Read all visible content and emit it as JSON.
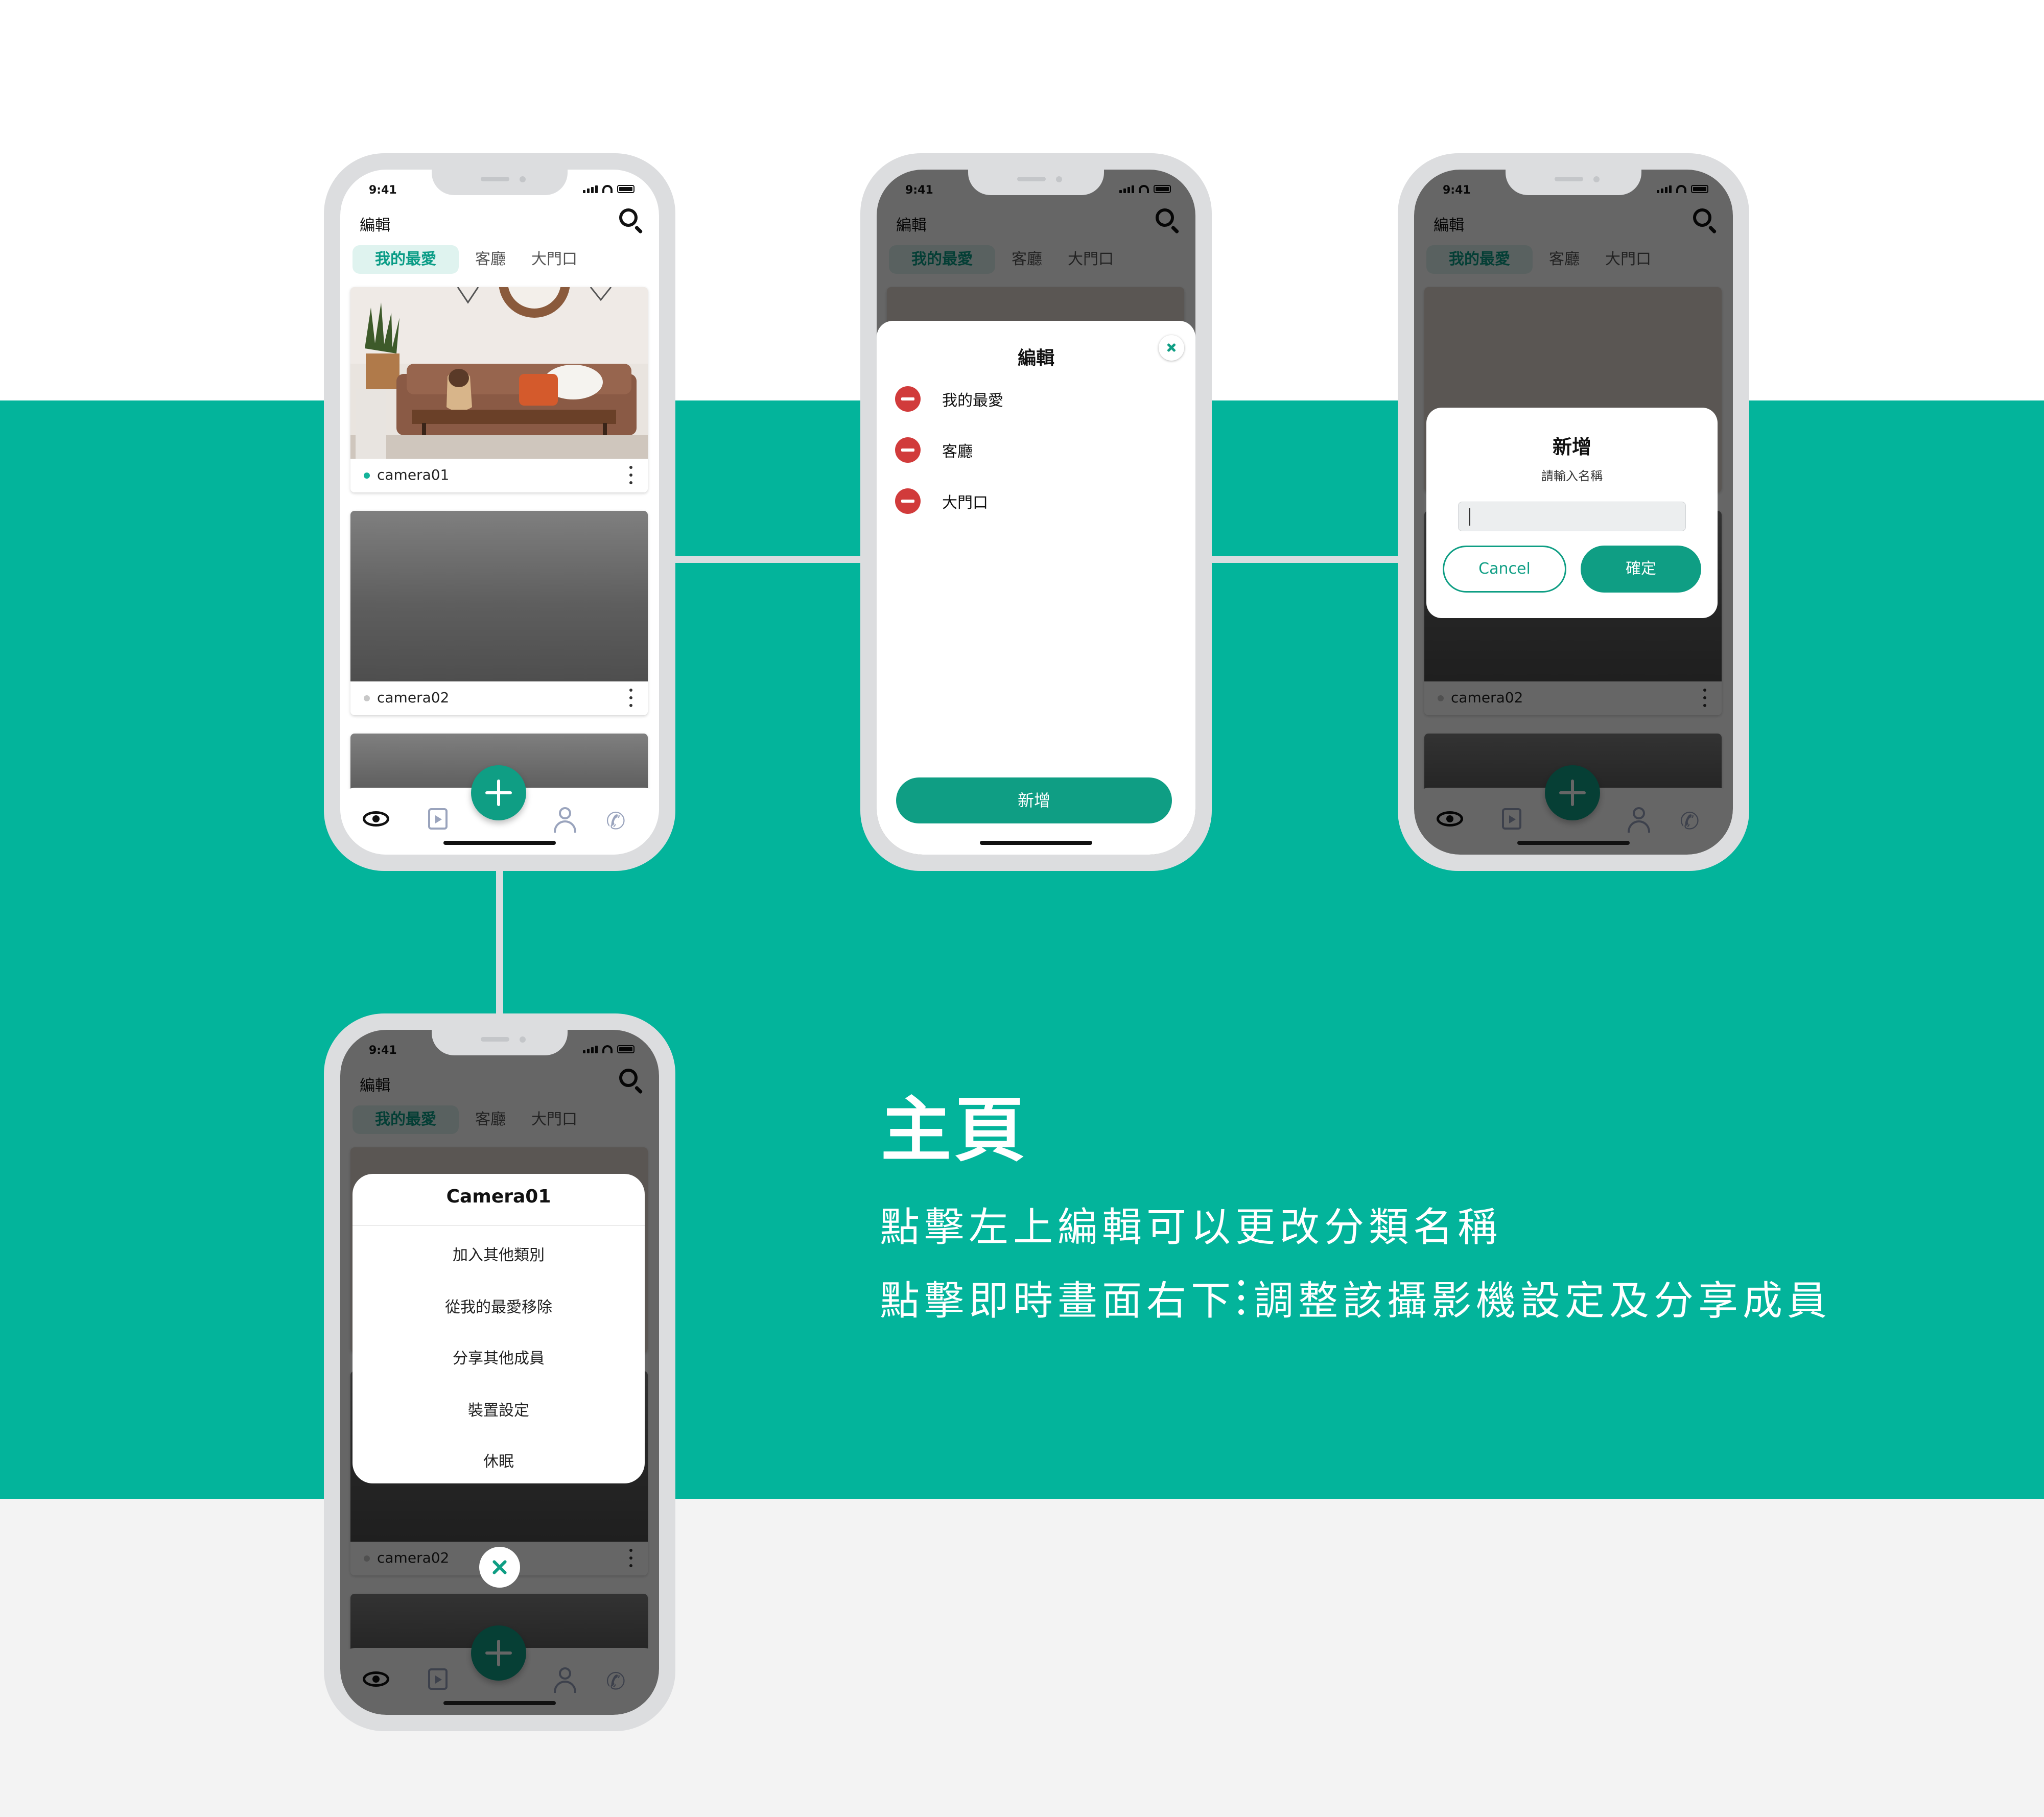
{
  "status": {
    "time": "9:41"
  },
  "home": {
    "edit_label": "編輯",
    "tabs": [
      "我的最愛",
      "客廳",
      "大門口"
    ],
    "cameras": [
      "camera01",
      "camera02"
    ]
  },
  "edit_sheet": {
    "title": "編輯",
    "items": [
      "我的最愛",
      "客廳",
      "大門口"
    ],
    "add_label": "新增"
  },
  "add_dialog": {
    "title": "新增",
    "subtitle": "請輸入名稱",
    "input_value": "",
    "cancel_label": "Cancel",
    "confirm_label": "確定"
  },
  "camera_menu": {
    "title": "Camera01",
    "items": [
      "加入其他類別",
      "從我的最愛移除",
      "分享其他成員",
      "裝置設定",
      "休眠"
    ]
  },
  "caption": {
    "heading": "主頁",
    "line1": "點擊左上編輯可以更改分類名稱",
    "line2_a": "點擊即時畫面右下",
    "line2_b": "調整該攝影機設定及分享成員"
  },
  "colors": {
    "teal_bg": "#03b49b",
    "brand": "#0f9e84",
    "delete_red": "#d13b3b"
  }
}
